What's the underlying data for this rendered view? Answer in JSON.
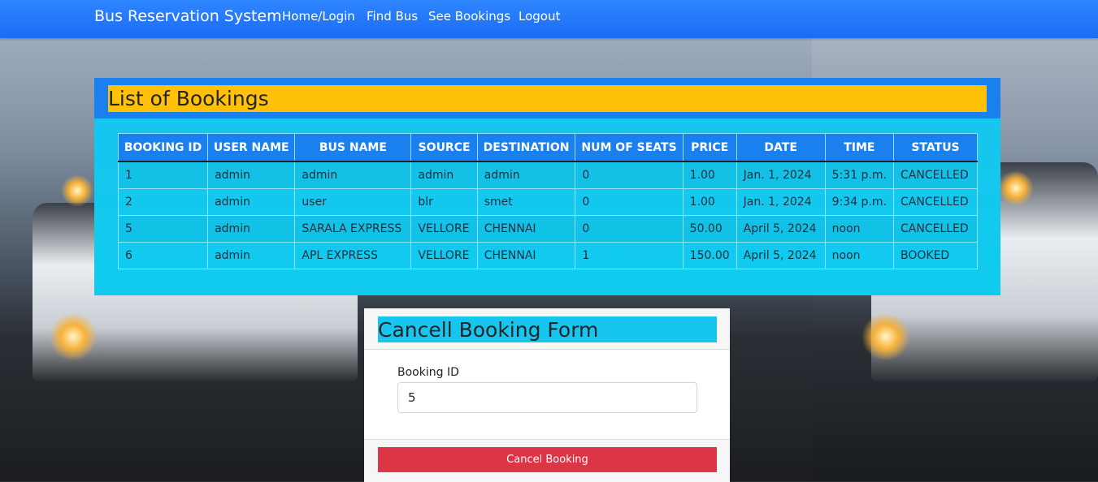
{
  "navbar": {
    "brand": "Bus Reservation System",
    "links": [
      "Home/Login",
      "Find Bus",
      "See Bookings",
      "Logout"
    ]
  },
  "bookings": {
    "title": "List of Bookings",
    "headers": [
      "BOOKING ID",
      "USER NAME",
      "BUS NAME",
      "SOURCE",
      "DESTINATION",
      "NUM OF SEATS",
      "PRICE",
      "DATE",
      "TIME",
      "STATUS"
    ],
    "rows": [
      [
        "1",
        "admin",
        "admin",
        "admin",
        "admin",
        "0",
        "1.00",
        "Jan. 1, 2024",
        "5:31 p.m.",
        "CANCELLED"
      ],
      [
        "2",
        "admin",
        "user",
        "blr",
        "smet",
        "0",
        "1.00",
        "Jan. 1, 2024",
        "9:34 p.m.",
        "CANCELLED"
      ],
      [
        "5",
        "admin",
        "SARALA EXPRESS",
        "VELLORE",
        "CHENNAI",
        "0",
        "50.00",
        "April 5, 2024",
        "noon",
        "CANCELLED"
      ],
      [
        "6",
        "admin",
        "APL EXPRESS",
        "VELLORE",
        "CHENNAI",
        "1",
        "150.00",
        "April 5, 2024",
        "noon",
        "BOOKED"
      ]
    ]
  },
  "cancel_form": {
    "title": "Cancell Booking Form",
    "booking_id_label": "Booking ID",
    "booking_id_value": "5",
    "submit_label": "Cancel Booking"
  },
  "colors": {
    "navbar": "#1b6cf2",
    "title_highlight": "#ffc107",
    "table_bg": "#10cbef",
    "danger": "#dc3545"
  }
}
